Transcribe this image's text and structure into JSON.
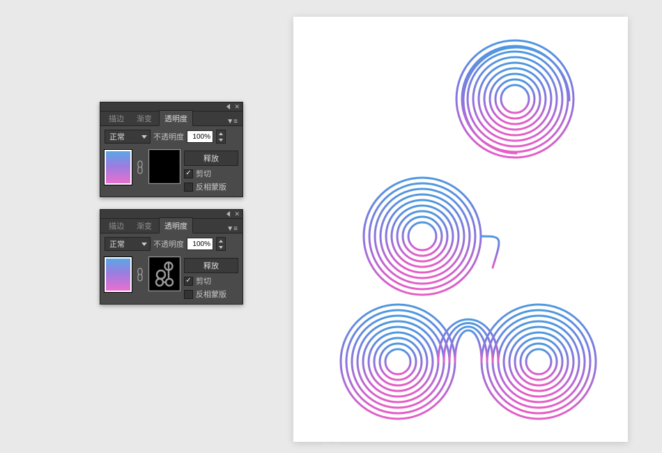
{
  "panel": {
    "tabs": {
      "stroke": "描边",
      "gradient": "渐变",
      "transparency": "透明度"
    },
    "blend_mode": "正常",
    "opacity_label": "不透明度",
    "opacity_value": "100%",
    "release_btn": "释放",
    "clip_label": "剪切",
    "invert_label": "反相蒙版",
    "clip_checked_1": true,
    "invert_checked_1": false,
    "clip_checked_2": true,
    "invert_checked_2": false
  },
  "colors": {
    "grad_top": "#4f98df",
    "grad_mid": "#8b74dd",
    "grad_bot": "#e75ec6"
  }
}
